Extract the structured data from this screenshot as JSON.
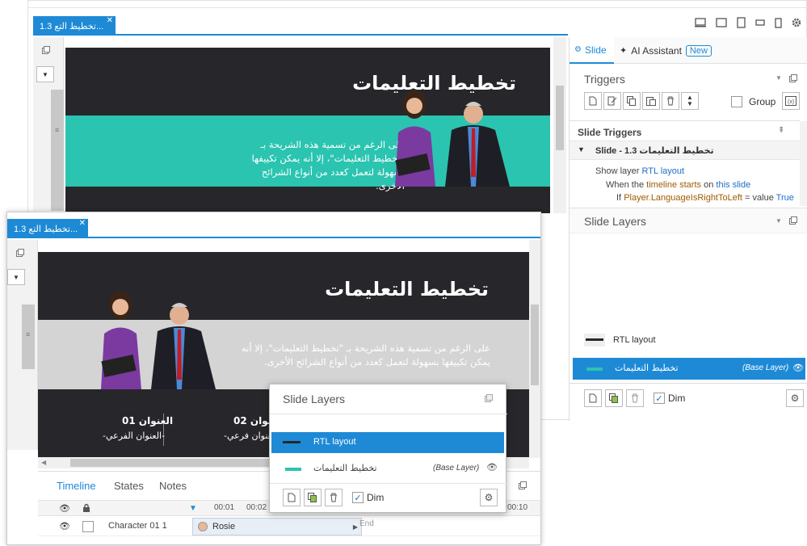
{
  "back_window": {
    "tab_title": "تخطيط التع 1.3...",
    "slide": {
      "title": "تخطيط التعليمات",
      "body": "على الرغم من تسمية هذه الشريحة بـ \"تخطيط التعليمات\"، إلا أنه يمكن تكييفها بسهولة لتعمل كعدد من أنواع الشرائح الأخرى.",
      "band_color": "#2bc4b0"
    },
    "panel_tabs": {
      "slide": "Slide",
      "ai_assistant": "AI Assistant",
      "new_badge": "New"
    },
    "triggers": {
      "heading": "Triggers",
      "group_label": "Group",
      "slide_triggers_heading": "Slide Triggers",
      "slide_row": "Slide - 1.3 تخطيط التعليمات",
      "action_show": "Show layer",
      "action_layer": "RTL layout",
      "when_prefix": "When the",
      "when_event": "timeline starts",
      "when_on": "on",
      "when_target": "this slide",
      "if_prefix": "If",
      "if_var": "Player.LanguageIsRightToLeft",
      "if_op": "= value",
      "if_value": "True"
    },
    "layers": {
      "heading": "Slide Layers",
      "rtl_layer": "RTL layout",
      "base_layer": "تخطيط التعليمات",
      "base_tag": "(Base Layer)",
      "dim_label": "Dim"
    }
  },
  "front_window": {
    "tab_title": "تخطيط التع 1.3...",
    "slide": {
      "title": "تخطيط التعليمات",
      "body": "على الرغم من تسمية هذه الشريحة بـ \"تخطيط التعليمات\"، إلا أنه يمكن تكييفها بسهولة لتعمل كعدد من أنواع الشرائح الأخرى.",
      "heading1": "العنوان 01",
      "sub1": "-العنوان الفرعي-",
      "heading2": "العنوان 02",
      "sub2": "-العنوان فرعي-"
    },
    "timeline": {
      "tabs": [
        "Timeline",
        "States",
        "Notes"
      ],
      "ticks": [
        "00:01",
        "00:02",
        "00:10"
      ],
      "row_name": "Character 01 1",
      "row_clip": "Rosie",
      "end_label": "End"
    }
  },
  "popup": {
    "heading": "Slide Layers",
    "rtl_layer": "RTL layout",
    "base_layer": "تخطيط التعليمات",
    "base_tag": "(Base Layer)",
    "dim_label": "Dim"
  },
  "colors": {
    "accent": "#1e8ad6",
    "slide_dark": "#27272b",
    "teal": "#2bc4b0"
  }
}
